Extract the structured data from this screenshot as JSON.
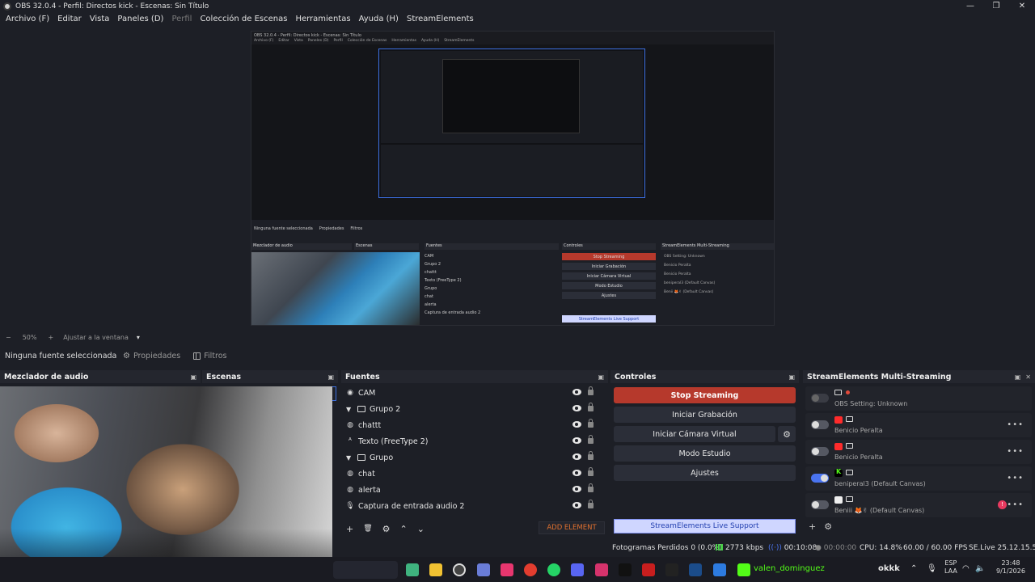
{
  "window": {
    "title": "OBS 32.0.4 - Perfil: Directos kick - Escenas: Sin Título",
    "minimize": "—",
    "maximize": "❐",
    "close": "✕"
  },
  "menu": [
    "Archivo (F)",
    "Editar",
    "Vista",
    "Paneles (D)",
    "Perfil",
    "Colección de Escenas",
    "Herramientas",
    "Ayuda (H)",
    "StreamElements"
  ],
  "preview": {
    "nested_title": "OBS 32.0.4 - Perfil: Directos kick - Escenas: Sin Título",
    "nested_menu": [
      "Archivo (F)",
      "Editar",
      "Vista",
      "Paneles (D)",
      "Perfil",
      "Colección de Escenas",
      "Herramientas",
      "Ayuda (H)",
      "StreamElements"
    ],
    "nested_none": "Ninguna fuente seleccionada",
    "nested_props": "Propiedades",
    "nested_filters": "Filtros",
    "nested_mixer": "Mezclador de audio",
    "nested_scenes": "Escenas",
    "nested_sources": "Fuentes",
    "nested_controls": "Controles",
    "nested_se": "StreamElements Multi-Streaming",
    "nested_sources_list": [
      "CAM",
      "Grupo 2",
      "chattt",
      "Texto (FreeType 2)",
      "Grupo",
      "chat",
      "alerta",
      "Captura de entrada audio 2"
    ],
    "nested_ctrl": [
      "Stop Streaming",
      "Iniciar Grabación",
      "Iniciar Cámara Virtual",
      "Modo Estudio",
      "Ajustes"
    ],
    "nested_se_list": [
      "OBS Setting: Unknown",
      "Benicio Peralta",
      "Benicio Peralta",
      "beniperal3 (Default Canvas)",
      "Benii 🦊✌ (Default Canvas)"
    ],
    "nested_support": "StreamElements Live Support",
    "nested_add": "ADD ELEMENT",
    "nested_status": "Fotogramas Perdidos 0 (0.0%)"
  },
  "zoom": {
    "minus": "−",
    "level": "50%",
    "plus": "+",
    "fit": "Ajustar a la ventana",
    "arrow": "▾"
  },
  "source_toolbar": {
    "none_selected": "Ninguna fuente seleccionada",
    "properties": "Propiedades",
    "filters": "Filtros"
  },
  "docks": {
    "mixer": "Mezclador de audio",
    "scenes": "Escenas",
    "sources": "Fuentes",
    "controls": "Controles",
    "multistreaming": "StreamElements Multi-Streaming"
  },
  "sources": [
    {
      "name": "CAM",
      "kind": "cam",
      "indent": 0
    },
    {
      "name": "Grupo 2",
      "kind": "group",
      "indent": 0
    },
    {
      "name": "chattt",
      "kind": "browser",
      "indent": 0
    },
    {
      "name": "Texto (FreeType 2)",
      "kind": "text",
      "indent": 0
    },
    {
      "name": "Grupo",
      "kind": "group",
      "indent": 0
    },
    {
      "name": "chat",
      "kind": "browser",
      "indent": 0
    },
    {
      "name": "alerta",
      "kind": "browser",
      "indent": 0
    },
    {
      "name": "Captura de entrada audio 2",
      "kind": "mic",
      "indent": 0
    }
  ],
  "source_tools": {
    "add": "+",
    "remove": "🗑",
    "settings": "⚙",
    "up": "⌃",
    "down": "⌄",
    "add_element": "ADD ELEMENT"
  },
  "controls": {
    "stop_streaming": "Stop Streaming",
    "start_recording": "Iniciar Grabación",
    "start_virtual_cam": "Iniciar Cámara Virtual",
    "studio_mode": "Modo Estudio",
    "settings": "Ajustes",
    "gear": "⚙",
    "se_support": "StreamElements Live Support"
  },
  "multistreaming": [
    {
      "name": "OBS Setting: Unknown",
      "platform": "none",
      "toggle": "dim"
    },
    {
      "name": "Benicio Peralta",
      "platform": "yt",
      "toggle": "off"
    },
    {
      "name": "Benicio Peralta",
      "platform": "yt",
      "toggle": "off"
    },
    {
      "name": "beniperal3 (Default Canvas)",
      "platform": "kick",
      "toggle": "on"
    },
    {
      "name": "Beniii 🦊✌ (Default Canvas)",
      "platform": "tt",
      "toggle": "off"
    }
  ],
  "sems_more": "•••",
  "sems_alert": "!",
  "sems_tools": {
    "add": "+",
    "settings": "⚙"
  },
  "status": {
    "dropped": "Fotogramas Perdidos 0 (0.0%)",
    "bitrate": "2773 kbps",
    "stream_time": "00:10:08",
    "rec_time": "00:00:00",
    "cpu": "CPU: 14.8%",
    "fps": "60.00 / 60.00 FPS",
    "version": "SE.Live 25.12.15.535"
  },
  "taskbar": {
    "kick_user": "valen_dominguez",
    "kick_text": "okkk",
    "lang": "ESP",
    "region": "LAA",
    "time": "23:48",
    "date": "9/1/2026",
    "tray_up": "⌃"
  },
  "colors": {
    "bg": "#1d1f26",
    "accent_blue": "#3c6fe0",
    "stop_red": "#b6392c",
    "add_orange": "#e0712f",
    "toggle_on": "#4a74f0"
  }
}
